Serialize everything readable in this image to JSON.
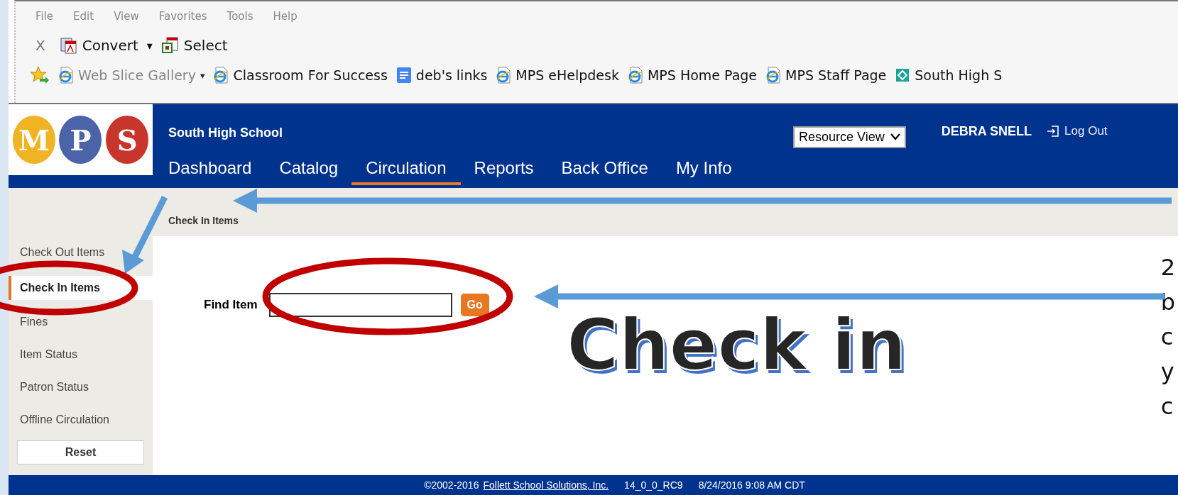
{
  "browser": {
    "menu": [
      "File",
      "Edit",
      "View",
      "Favorites",
      "Tools",
      "Help"
    ],
    "toolbar": {
      "close": "X",
      "convert": "Convert",
      "caret": "▾",
      "select": "Select"
    },
    "favorites": [
      {
        "label": "Web Slice Gallery",
        "kind": "ie",
        "caret": "▾",
        "dimmed": true
      },
      {
        "label": "Classroom For Success",
        "kind": "ie",
        "dimmed": false
      },
      {
        "label": "deb's links",
        "kind": "doc",
        "dimmed": false
      },
      {
        "label": "MPS eHelpdesk",
        "kind": "ie",
        "dimmed": false
      },
      {
        "label": "MPS Home Page",
        "kind": "ie",
        "dimmed": false
      },
      {
        "label": "MPS Staff Page",
        "kind": "ie",
        "dimmed": false
      },
      {
        "label": "South High S",
        "kind": "site",
        "dimmed": false
      }
    ]
  },
  "header": {
    "logo": [
      "M",
      "P",
      "S"
    ],
    "school": "South High School",
    "view_select": "Resource View",
    "user": "DEBRA SNELL",
    "logout": "Log Out",
    "nav": [
      {
        "label": "Dashboard",
        "selected": false
      },
      {
        "label": "Catalog",
        "selected": false
      },
      {
        "label": "Circulation",
        "selected": true
      },
      {
        "label": "Reports",
        "selected": false
      },
      {
        "label": "Back Office",
        "selected": false
      },
      {
        "label": "My Info",
        "selected": false
      }
    ]
  },
  "breadcrumb": "Check In Items",
  "sidebar": {
    "items": [
      {
        "label": "Check Out Items",
        "selected": false
      },
      {
        "label": "Check In Items",
        "selected": true
      },
      {
        "label": "Fines",
        "selected": false
      },
      {
        "label": "Item Status",
        "selected": false
      },
      {
        "label": "Patron Status",
        "selected": false
      },
      {
        "label": "Offline Circulation",
        "selected": false
      }
    ],
    "reset": "Reset"
  },
  "find": {
    "label": "Find Item",
    "go": "Go"
  },
  "annotation": {
    "title": "Check in",
    "side_text": [
      "2",
      "b",
      "c",
      "y",
      "c"
    ]
  },
  "footer": {
    "copyright": "©2002-2016",
    "link": "Follett School Solutions, Inc.",
    "version": "14_0_0_RC9",
    "timestamp": "8/24/2016 9:08 AM CDT"
  }
}
